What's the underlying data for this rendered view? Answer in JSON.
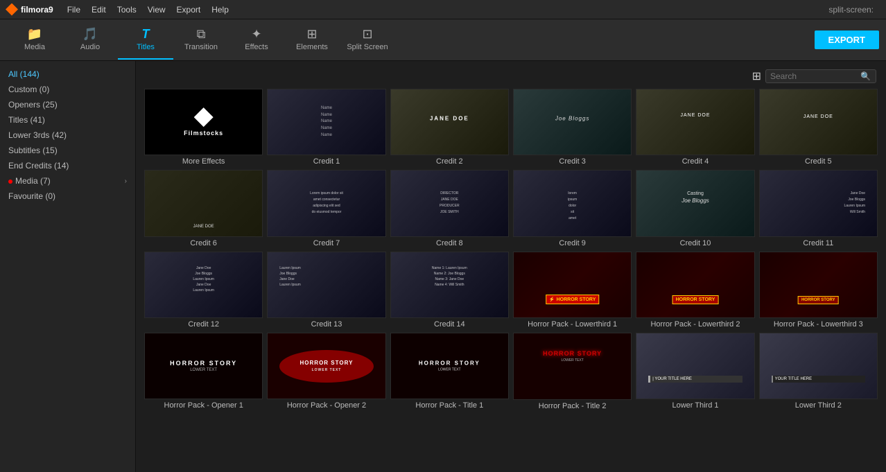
{
  "app": {
    "name": "filmora9",
    "split_screen_label": "split-screen:"
  },
  "menu": {
    "items": [
      "File",
      "Edit",
      "Tools",
      "View",
      "Export",
      "Help"
    ]
  },
  "toolbar": {
    "items": [
      {
        "id": "media",
        "label": "Media",
        "icon": "📁"
      },
      {
        "id": "audio",
        "label": "Audio",
        "icon": "🎵"
      },
      {
        "id": "titles",
        "label": "Titles",
        "icon": "T",
        "active": true
      },
      {
        "id": "transition",
        "label": "Transition",
        "icon": "⧉"
      },
      {
        "id": "effects",
        "label": "Effects",
        "icon": "✦"
      },
      {
        "id": "elements",
        "label": "Elements",
        "icon": "⊞"
      },
      {
        "id": "split-screen",
        "label": "Split Screen",
        "icon": "⊡"
      }
    ],
    "export_label": "EXPORT"
  },
  "sidebar": {
    "items": [
      {
        "label": "All (144)",
        "active": true
      },
      {
        "label": "Custom (0)"
      },
      {
        "label": "Openers (25)"
      },
      {
        "label": "Titles (41)"
      },
      {
        "label": "Lower 3rds (42)"
      },
      {
        "label": "Subtitles (15)"
      },
      {
        "label": "End Credits (14)"
      },
      {
        "label": "Media (7)",
        "has_dot": true,
        "has_arrow": true
      },
      {
        "label": "Favourite (0)"
      }
    ]
  },
  "search": {
    "placeholder": "Search"
  },
  "grid": {
    "items": [
      {
        "id": "more-effects",
        "label": "More Effects",
        "type": "filmstocks"
      },
      {
        "id": "credit-1",
        "label": "Credit 1",
        "type": "credit-list"
      },
      {
        "id": "credit-2",
        "label": "Credit 2",
        "type": "credit-jane"
      },
      {
        "id": "credit-3",
        "label": "Credit 3",
        "type": "credit-joe"
      },
      {
        "id": "credit-4",
        "label": "Credit 4",
        "type": "credit-jane2"
      },
      {
        "id": "credit-5",
        "label": "Credit 5",
        "type": "credit-jane3"
      },
      {
        "id": "credit-6",
        "label": "Credit 6",
        "type": "credit-jane4"
      },
      {
        "id": "credit-7",
        "label": "Credit 7",
        "type": "credit-list2"
      },
      {
        "id": "credit-8",
        "label": "Credit 8",
        "type": "credit-list3"
      },
      {
        "id": "credit-9",
        "label": "Credit 9",
        "type": "credit-list4"
      },
      {
        "id": "credit-10",
        "label": "Credit 10",
        "type": "credit-joe2"
      },
      {
        "id": "credit-11",
        "label": "Credit 11",
        "type": "credit-list5"
      },
      {
        "id": "credit-12",
        "label": "Credit 12",
        "type": "credit-list6"
      },
      {
        "id": "credit-13",
        "label": "Credit 13",
        "type": "credit-list7"
      },
      {
        "id": "credit-14",
        "label": "Credit 14",
        "type": "credit-list8"
      },
      {
        "id": "horror-lower-1",
        "label": "Horror Pack - Lowerthird 1",
        "type": "horror-lower1"
      },
      {
        "id": "horror-lower-2",
        "label": "Horror Pack - Lowerthird 2",
        "type": "horror-lower2"
      },
      {
        "id": "horror-lower-3",
        "label": "Horror Pack - Lowerthird 3",
        "type": "horror-lower3"
      },
      {
        "id": "horror-opener-1",
        "label": "Horror Pack - Opener 1",
        "type": "horror-opener1"
      },
      {
        "id": "horror-opener-2",
        "label": "Horror Pack - Opener 2",
        "type": "horror-opener2"
      },
      {
        "id": "horror-title-1",
        "label": "Horror Pack - Title 1",
        "type": "horror-title1"
      },
      {
        "id": "horror-title-2",
        "label": "Horror Pack - Title 2",
        "type": "horror-title2"
      },
      {
        "id": "lower-third-1",
        "label": "Lower Third 1",
        "type": "lower-third1"
      },
      {
        "id": "lower-third-2",
        "label": "Lower Third 2",
        "type": "lower-third2"
      }
    ]
  }
}
